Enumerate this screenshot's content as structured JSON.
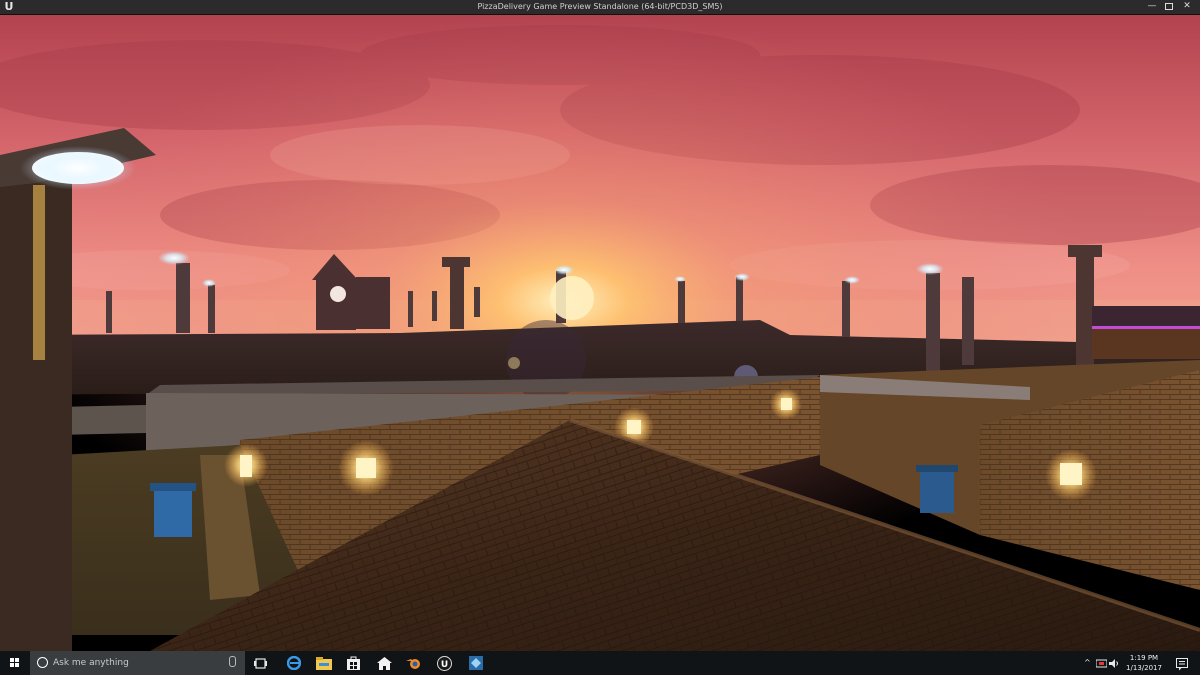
{
  "window": {
    "title": "PizzaDelivery Game Preview Standalone (64-bit/PCD3D_SM5)",
    "logo": "U",
    "controls": {
      "minimize": "—",
      "close": "✕"
    }
  },
  "viewport": {
    "scene_description_icon": "game-scene"
  },
  "taskbar": {
    "search_placeholder": "Ask me anything",
    "pinned": [
      "task-view-icon",
      "edge-icon",
      "file-explorer-icon",
      "store-icon",
      "home-icon",
      "blender-icon",
      "unreal-engine-icon",
      "app-icon"
    ],
    "tray": {
      "chevron": "^",
      "time": "1:19 PM",
      "date": "1/13/2017"
    }
  },
  "colors": {
    "taskbar": "#101417",
    "titlebar": "#2b2b2b",
    "sky_top": "#c24d57",
    "sky_horizon": "#f08a7a",
    "sun": "#ffd27a"
  }
}
